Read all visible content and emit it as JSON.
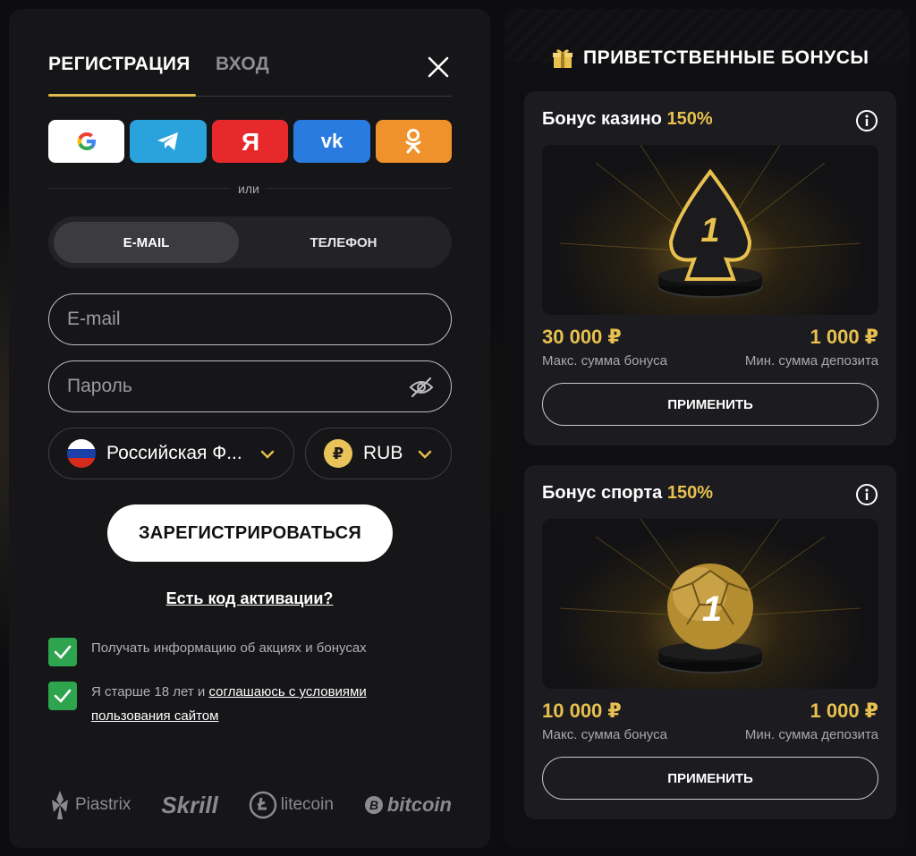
{
  "tabs": {
    "register": "РЕГИСТРАЦИЯ",
    "login": "ВХОД"
  },
  "socials": [
    "google-icon",
    "telegram-icon",
    "yandex-icon",
    "vk-icon",
    "ok-icon"
  ],
  "divider_text": "или",
  "method_switch": {
    "email": "E-MAIL",
    "phone": "ТЕЛЕФОН",
    "selected": "E-MAIL"
  },
  "fields": {
    "email_placeholder": "E-mail",
    "password_placeholder": "Пароль"
  },
  "country": {
    "label": "Российская Ф...",
    "flag_colors": [
      "#ffffff",
      "#1c3fa8",
      "#d52b1e"
    ]
  },
  "currency": {
    "symbol": "₽",
    "label": "RUB"
  },
  "register_button": "ЗАРЕГИСТРИРОВАТЬСЯ",
  "activation_link": "Есть код активации?",
  "checkboxes": {
    "promo": {
      "text": "Получать информацию об акциях и бонусах",
      "checked": true
    },
    "terms": {
      "prefix": "Я старше 18 лет и ",
      "link": "соглашаюсь с условиями пользования сайтом",
      "checked": true
    }
  },
  "payment_logos": {
    "piastrix": "Piastrix",
    "skrill": "Skrill",
    "litecoin": "litecoin",
    "bitcoin": "bitcoin"
  },
  "bonuses": {
    "header": "ПРИВЕТСТВЕННЫЕ БОНУСЫ",
    "casino": {
      "title": "Бонус казино",
      "percent": "150%",
      "max_amount": "30 000 ₽",
      "max_label": "Макс. сумма бонуса",
      "min_amount": "1 000 ₽",
      "min_label": "Мин. сумма депозита",
      "apply": "ПРИМЕНИТЬ"
    },
    "sport": {
      "title": "Бонус спорта",
      "percent": "150%",
      "max_amount": "10 000 ₽",
      "max_label": "Макс. сумма бонуса",
      "min_amount": "1 000 ₽",
      "min_label": "Мин. сумма депозита",
      "apply": "ПРИМЕНИТЬ"
    }
  },
  "colors": {
    "accent_gold": "#e7c04e",
    "check_green": "#2ea44f",
    "panel": "#161619"
  }
}
